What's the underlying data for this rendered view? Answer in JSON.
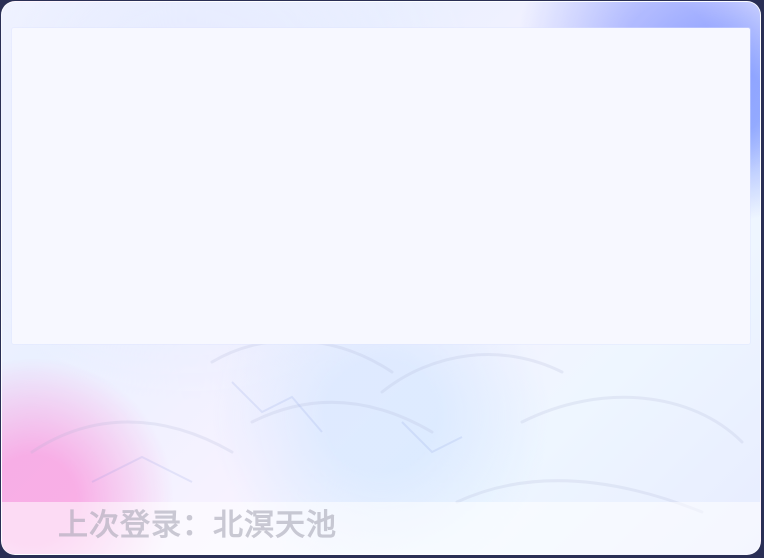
{
  "window": {
    "last_login_text": "上次登录：北溟天池"
  }
}
